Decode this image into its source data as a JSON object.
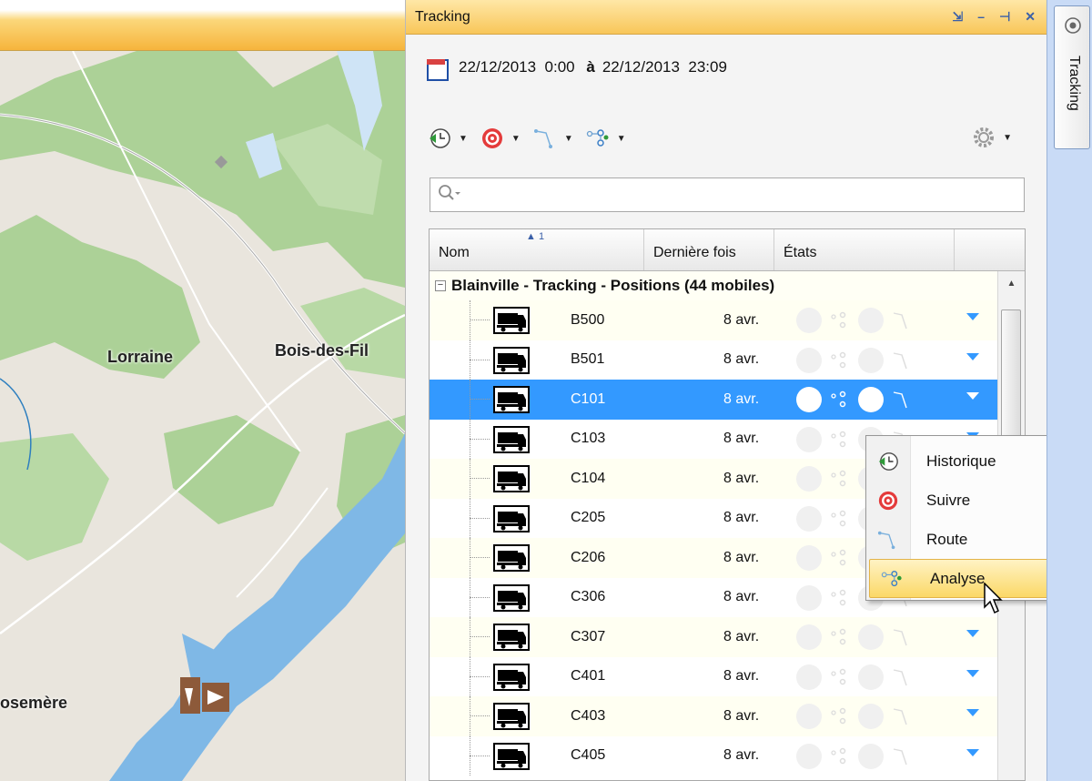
{
  "map": {
    "labels": {
      "lorraine": "Lorraine",
      "bois_des_filion": "Bois-des-Fil",
      "rosemere": "osemère"
    }
  },
  "panel": {
    "title": "Tracking",
    "header_controls": [
      "pin-out",
      "minimize",
      "pin",
      "close"
    ],
    "date_range": {
      "start_date": "22/12/2013",
      "start_time": "0:00",
      "separator": "à",
      "end_date": "22/12/2013",
      "end_time": "23:09"
    },
    "toolbar": [
      "history",
      "follow",
      "route",
      "analysis",
      "settings"
    ],
    "search_placeholder": ""
  },
  "grid": {
    "sort_indicator": "1",
    "columns": {
      "name": "Nom",
      "last_time": "Dernière fois",
      "states": "États"
    },
    "group": "Blainville - Tracking - Positions (44 mobiles)",
    "rows": [
      {
        "name": "B500",
        "time": "8 avr.",
        "selected": false
      },
      {
        "name": "B501",
        "time": "8 avr.",
        "selected": false
      },
      {
        "name": "C101",
        "time": "8 avr.",
        "selected": true
      },
      {
        "name": "C103",
        "time": "8 avr.",
        "selected": false
      },
      {
        "name": "C104",
        "time": "8 avr.",
        "selected": false
      },
      {
        "name": "C205",
        "time": "8 avr.",
        "selected": false
      },
      {
        "name": "C206",
        "time": "8 avr.",
        "selected": false
      },
      {
        "name": "C306",
        "time": "8 avr.",
        "selected": false
      },
      {
        "name": "C307",
        "time": "8 avr.",
        "selected": false
      },
      {
        "name": "C401",
        "time": "8 avr.",
        "selected": false
      },
      {
        "name": "C403",
        "time": "8 avr.",
        "selected": false
      },
      {
        "name": "C405",
        "time": "8 avr.",
        "selected": false
      }
    ]
  },
  "context_menu": {
    "items": [
      {
        "label": "Historique",
        "icon": "history-icon",
        "highlighted": false
      },
      {
        "label": "Suivre",
        "icon": "target-icon",
        "highlighted": false
      },
      {
        "label": "Route",
        "icon": "route-icon",
        "highlighted": false
      },
      {
        "label": "Analyse",
        "icon": "analysis-icon",
        "highlighted": true
      }
    ]
  },
  "side_tab": {
    "label": "Tracking"
  },
  "colors": {
    "selection": "#3399ff",
    "header_gold": "#f8c659",
    "water": "#7fb8e6",
    "forest": "#a9cf95"
  }
}
